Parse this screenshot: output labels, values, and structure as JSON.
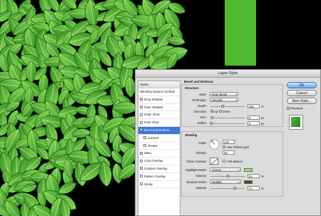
{
  "dialog": {
    "title": "Layer Style",
    "styles_header": "Styles",
    "style_items": [
      {
        "label": "Blending Options: Default",
        "checkbox": false,
        "checked": false,
        "indent": false,
        "selected": false
      },
      {
        "label": "Drop Shadow",
        "checkbox": true,
        "checked": true,
        "indent": false,
        "selected": false
      },
      {
        "label": "Inner Shadow",
        "checkbox": true,
        "checked": false,
        "indent": false,
        "selected": false
      },
      {
        "label": "Outer Glow",
        "checkbox": true,
        "checked": false,
        "indent": false,
        "selected": false
      },
      {
        "label": "Inner Glow",
        "checkbox": true,
        "checked": false,
        "indent": false,
        "selected": false
      },
      {
        "label": "Bevel and Emboss",
        "checkbox": true,
        "checked": true,
        "indent": false,
        "selected": true
      },
      {
        "label": "Contour",
        "checkbox": true,
        "checked": false,
        "indent": true,
        "selected": false
      },
      {
        "label": "Texture",
        "checkbox": true,
        "checked": false,
        "indent": true,
        "selected": false
      },
      {
        "label": "Satin",
        "checkbox": true,
        "checked": true,
        "indent": false,
        "selected": false
      },
      {
        "label": "Color Overlay",
        "checkbox": true,
        "checked": false,
        "indent": false,
        "selected": false
      },
      {
        "label": "Gradient Overlay",
        "checkbox": true,
        "checked": true,
        "indent": false,
        "selected": false
      },
      {
        "label": "Pattern Overlay",
        "checkbox": true,
        "checked": false,
        "indent": false,
        "selected": false
      },
      {
        "label": "Stroke",
        "checkbox": true,
        "checked": false,
        "indent": false,
        "selected": false
      }
    ],
    "bevel": {
      "section_title": "Bevel and Emboss",
      "structure_title": "Structure",
      "style_label": "Style:",
      "style_value": "Inner Bevel",
      "technique_label": "Technique:",
      "technique_value": "Smooth",
      "depth_label": "Depth:",
      "depth_value": "181",
      "depth_unit": "%",
      "depth_level": 0.36,
      "direction_label": "Direction:",
      "direction_up": "Up",
      "direction_down": "Down",
      "size_label": "Size:",
      "size_value": "6",
      "size_unit": "px",
      "size_level": 0.05,
      "soften_label": "Soften:",
      "soften_value": "3",
      "soften_unit": "px",
      "soften_level": 0.03
    },
    "shading": {
      "title": "Shading",
      "angle_label": "Angle:",
      "angle_value": "120",
      "angle_unit": "°",
      "global_light_label": "Use Global Light",
      "altitude_label": "Altitude:",
      "altitude_value": "30",
      "gloss_contour_label": "Gloss Contour:",
      "anti_aliased_label": "Anti-aliased",
      "highlight_mode_label": "Highlight Mode:",
      "highlight_mode_value": "Screen",
      "highlight_color": "#9ee06a",
      "highlight_opacity_label": "Opacity:",
      "highlight_opacity_value": "51",
      "highlight_opacity_unit": "%",
      "highlight_opacity_level": 0.51,
      "shadow_mode_label": "Shadow Mode:",
      "shadow_mode_value": "Multiply",
      "shadow_color": "#2e5e12",
      "shadow_opacity_label": "Opacity:",
      "shadow_opacity_value": "71",
      "shadow_opacity_unit": "%",
      "shadow_opacity_level": 0.71
    },
    "buttons": {
      "ok": "OK",
      "cancel": "Cancel",
      "new_style": "New Style..."
    },
    "preview_label": "Preview"
  }
}
